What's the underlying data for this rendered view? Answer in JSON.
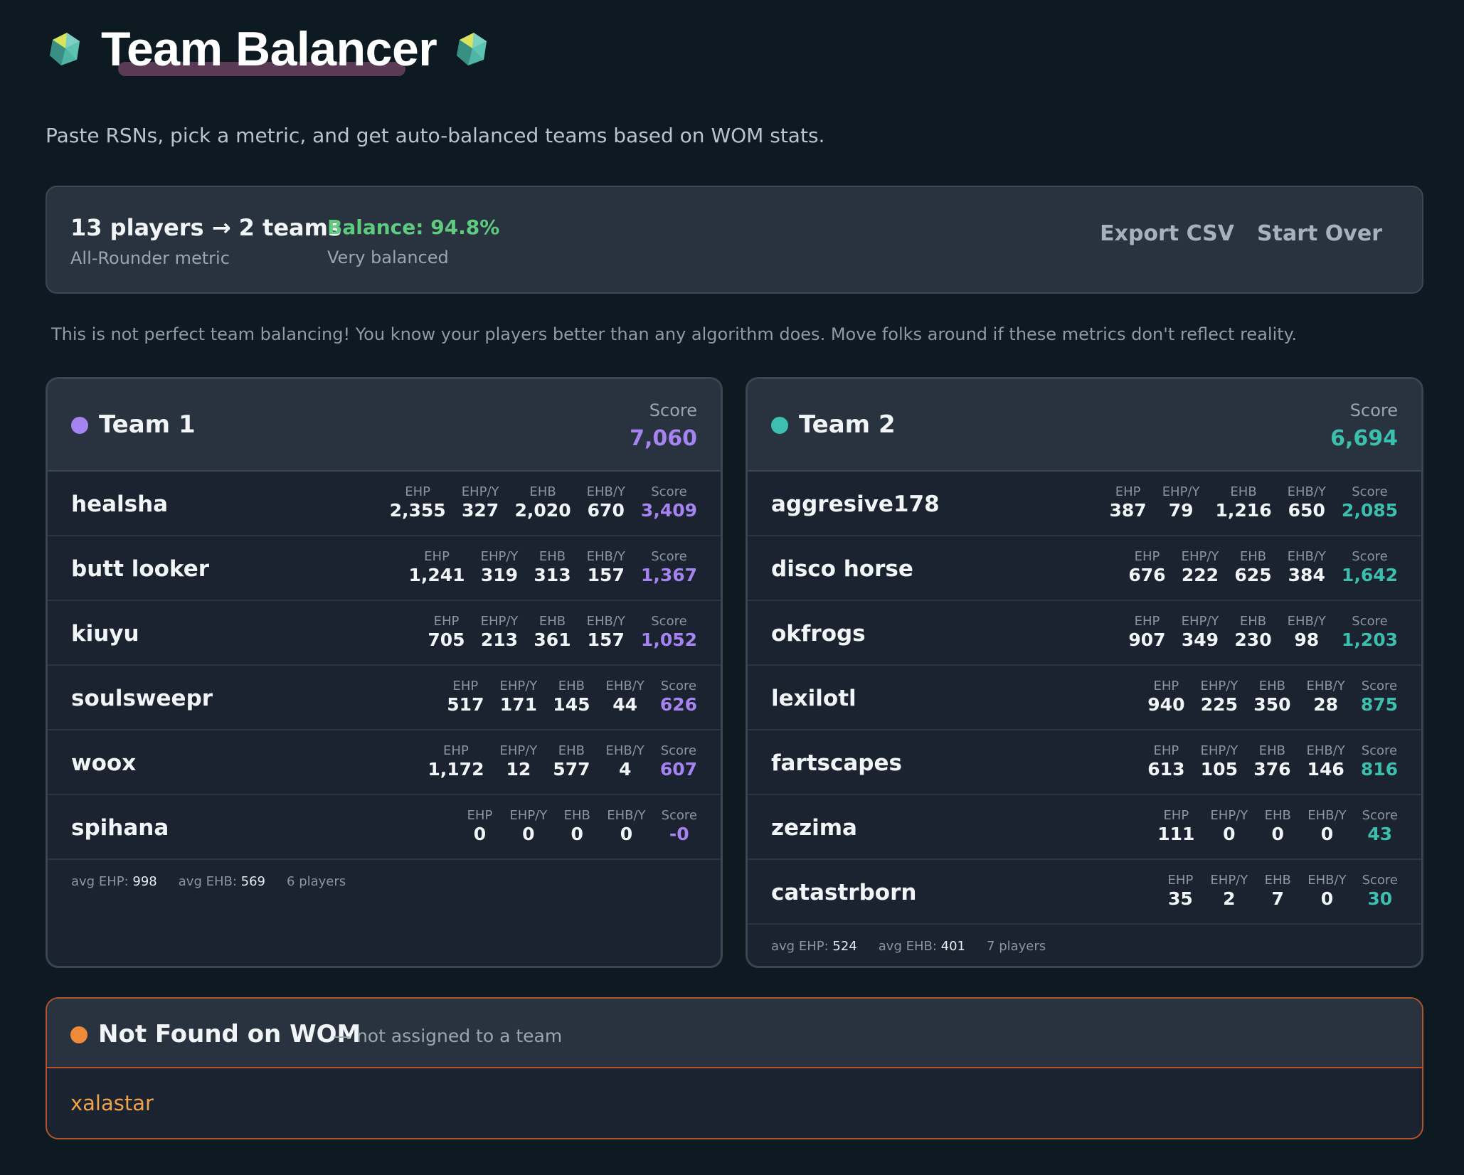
{
  "header": {
    "title": "Team Balancer",
    "subtitle": "Paste RSNs, pick a metric, and get auto-balanced teams based on WOM stats.",
    "left_icon": "gem-icon",
    "right_icon": "gem-icon"
  },
  "summary": {
    "players_teams": "13 players → 2 teams",
    "metric": "All-Rounder metric",
    "balance": "Balance: 94.8%",
    "balance_desc": "Very balanced",
    "export_label": "Export CSV",
    "start_over_label": "Start Over"
  },
  "note": "This is not perfect team balancing! You know your players better than any algorithm does. Move folks around if these metrics don't reflect reality.",
  "colors": {
    "team1": "#a583f0",
    "team2": "#3cbfae",
    "not_found": "#f08a3a",
    "balance_good": "#5ecb7f"
  },
  "stat_labels": [
    "EHP",
    "EHP/Y",
    "EHB",
    "EHB/Y",
    "Score"
  ],
  "teams": [
    {
      "name": "Team 1",
      "score_label": "Score",
      "score": "7,060",
      "players": [
        {
          "rsn": "healsha",
          "stats": [
            "2,355",
            "327",
            "2,020",
            "670",
            "3,409"
          ]
        },
        {
          "rsn": "butt looker",
          "stats": [
            "1,241",
            "319",
            "313",
            "157",
            "1,367"
          ]
        },
        {
          "rsn": "kiuyu",
          "stats": [
            "705",
            "213",
            "361",
            "157",
            "1,052"
          ]
        },
        {
          "rsn": "soulsweepr",
          "stats": [
            "517",
            "171",
            "145",
            "44",
            "626"
          ]
        },
        {
          "rsn": "woox",
          "stats": [
            "1,172",
            "12",
            "577",
            "4",
            "607"
          ]
        },
        {
          "rsn": "spihana",
          "stats": [
            "0",
            "0",
            "0",
            "0",
            "-0"
          ]
        }
      ],
      "footer": {
        "avg_ehp_label": "avg EHP:",
        "avg_ehp": "998",
        "avg_ehb_label": "avg EHB:",
        "avg_ehb": "569",
        "count": "6 players"
      }
    },
    {
      "name": "Team 2",
      "score_label": "Score",
      "score": "6,694",
      "players": [
        {
          "rsn": "aggresive178",
          "stats": [
            "387",
            "79",
            "1,216",
            "650",
            "2,085"
          ]
        },
        {
          "rsn": "disco horse",
          "stats": [
            "676",
            "222",
            "625",
            "384",
            "1,642"
          ]
        },
        {
          "rsn": "okfrogs",
          "stats": [
            "907",
            "349",
            "230",
            "98",
            "1,203"
          ]
        },
        {
          "rsn": "lexilotl",
          "stats": [
            "940",
            "225",
            "350",
            "28",
            "875"
          ]
        },
        {
          "rsn": "fartscapes",
          "stats": [
            "613",
            "105",
            "376",
            "146",
            "816"
          ]
        },
        {
          "rsn": "zezima",
          "stats": [
            "111",
            "0",
            "0",
            "0",
            "43"
          ]
        },
        {
          "rsn": "catastrborn",
          "stats": [
            "35",
            "2",
            "7",
            "0",
            "30"
          ]
        }
      ],
      "footer": {
        "avg_ehp_label": "avg EHP:",
        "avg_ehp": "524",
        "avg_ehb_label": "avg EHB:",
        "avg_ehb": "401",
        "count": "7 players"
      }
    }
  ],
  "not_found": {
    "title": "Not Found on WOM",
    "subtitle": "— not assigned to a team",
    "players": [
      "xalastar"
    ]
  }
}
